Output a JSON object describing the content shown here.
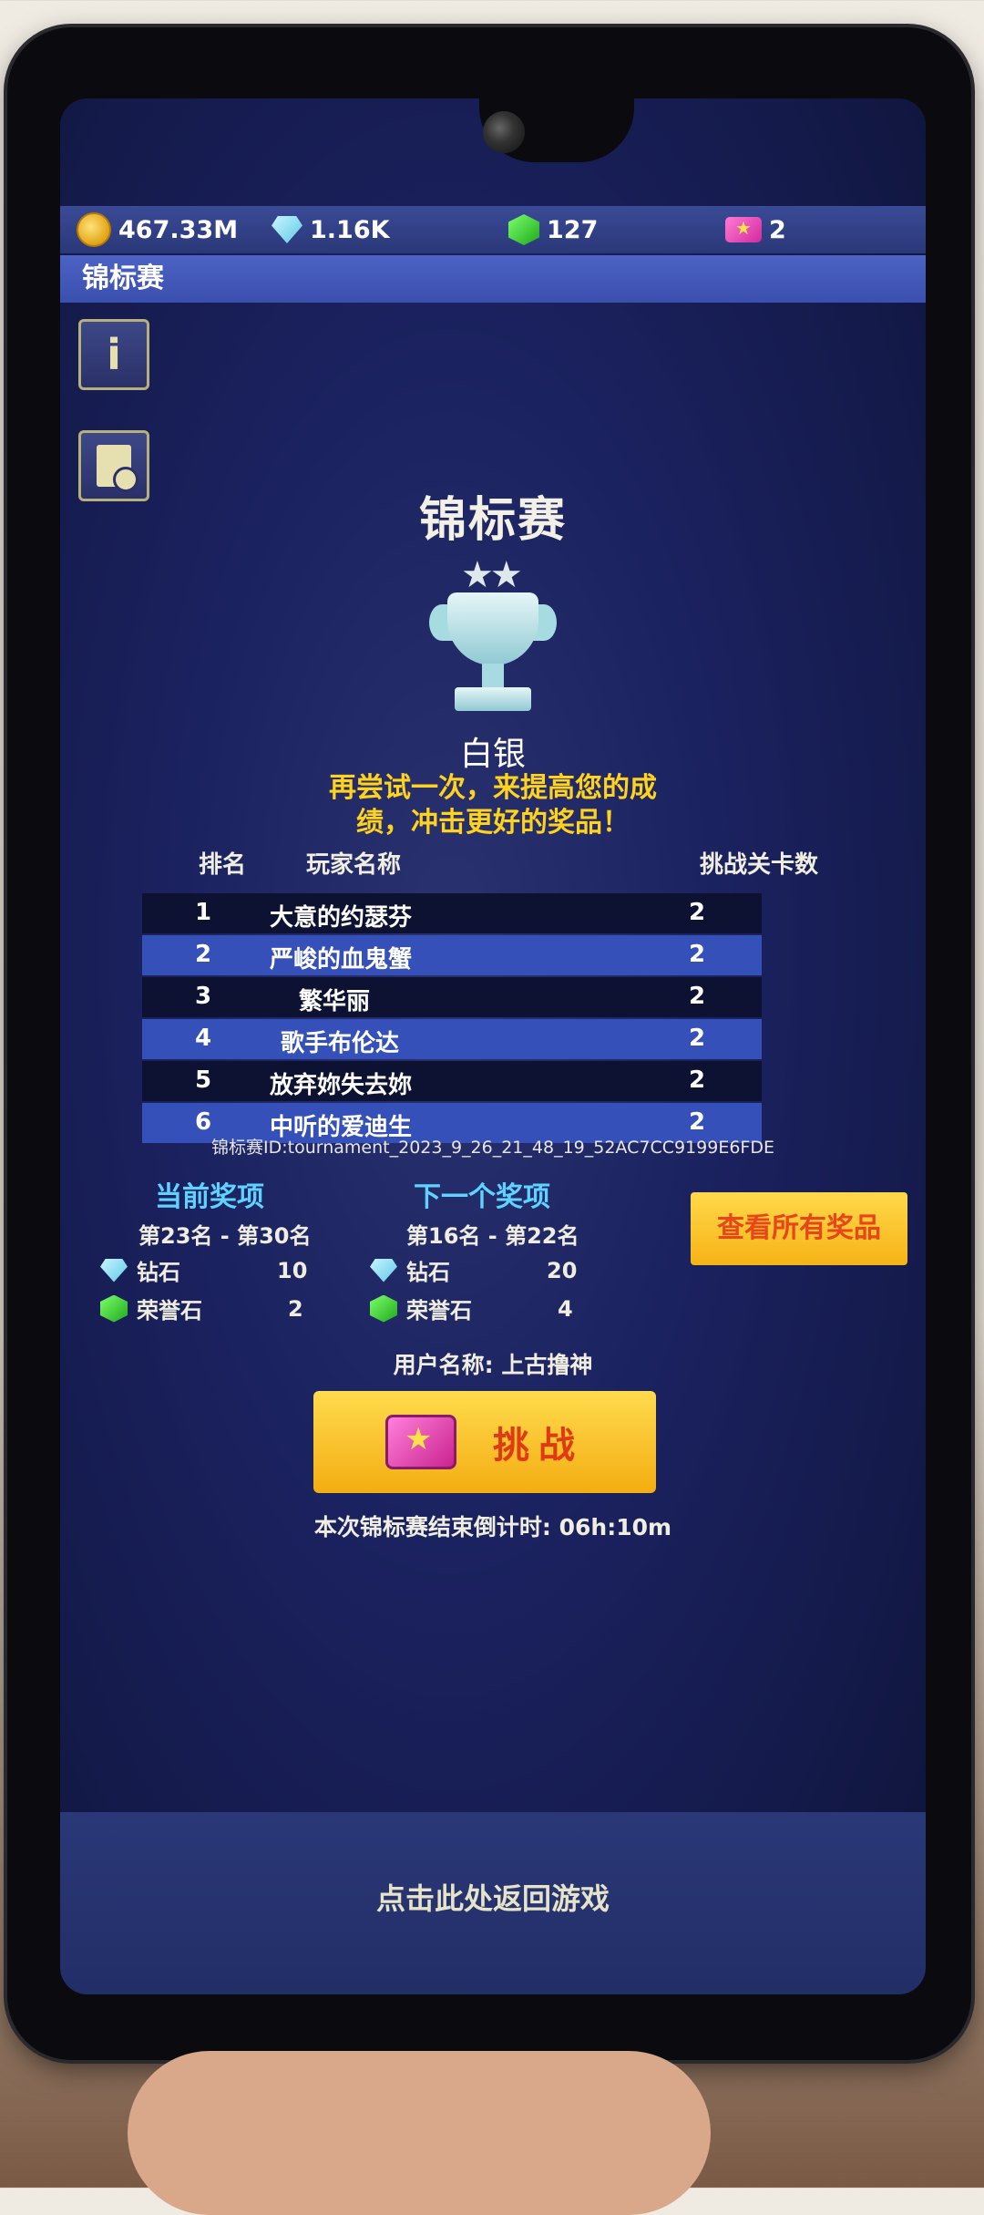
{
  "currencies": {
    "gold": "467.33M",
    "diamond": "1.16K",
    "honor": "127",
    "tickets": "2"
  },
  "header": {
    "title": "锦标赛"
  },
  "main": {
    "title": "锦标赛",
    "rank_name": "白银",
    "encourage_line1": "再尝试一次，来提高您的成",
    "encourage_line2": "绩，冲击更好的奖品！"
  },
  "table": {
    "col_rank": "排名",
    "col_player": "玩家名称",
    "col_levels": "挑战关卡数",
    "rows": [
      {
        "rank": "1",
        "name": "大意的约瑟芬",
        "levels": "2"
      },
      {
        "rank": "2",
        "name": "严峻的血鬼蟹",
        "levels": "2"
      },
      {
        "rank": "3",
        "name": "繁华丽",
        "levels": "2"
      },
      {
        "rank": "4",
        "name": "歌手布伦达",
        "levels": "2"
      },
      {
        "rank": "5",
        "name": "放弃妳失去妳",
        "levels": "2"
      },
      {
        "rank": "6",
        "name": "中听的爱迪生",
        "levels": "2"
      }
    ],
    "tournament_id": "锦标赛ID:tournament_2023_9_26_21_48_19_52AC7CC9199E6FDE"
  },
  "current_prize": {
    "title": "当前奖项",
    "range": "第23名 - 第30名",
    "diamond_label": "钻石",
    "diamond_amount": "10",
    "honor_label": "荣誉石",
    "honor_amount": "2"
  },
  "next_prize": {
    "title": "下一个奖项",
    "range": "第16名 - 第22名",
    "diamond_label": "钻石",
    "diamond_amount": "20",
    "honor_label": "荣誉石",
    "honor_amount": "4"
  },
  "view_all_label": "查看所有奖品",
  "user_line": "用户名称:  上古撸神",
  "challenge_label": "挑战",
  "countdown": "本次锦标赛结束倒计时: 06h:10m",
  "back_label": "点击此处返回游戏"
}
